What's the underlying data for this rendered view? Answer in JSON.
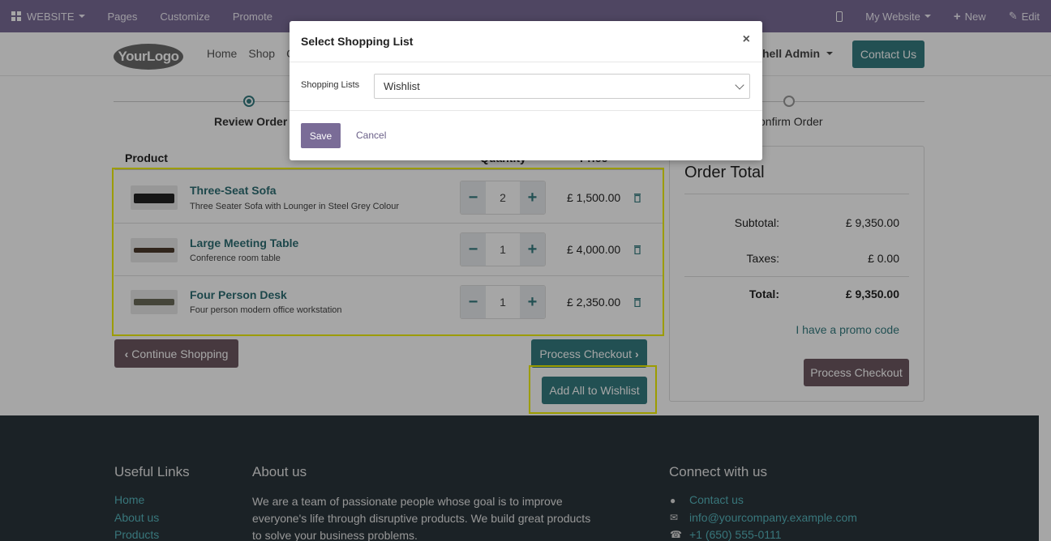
{
  "admin_bar": {
    "website": "WEBSITE",
    "pages": "Pages",
    "customize": "Customize",
    "promote": "Promote",
    "my_website": "My Website",
    "new": "New",
    "edit": "Edit"
  },
  "header": {
    "logo": "YourLogo",
    "nav": [
      "Home",
      "Shop",
      "C"
    ],
    "user": "hell Admin",
    "contact": "Contact Us"
  },
  "steps": {
    "review": "Review Order",
    "confirm": "onfirm Order"
  },
  "cart": {
    "col_product": "Product",
    "col_quantity": "Quantity",
    "col_price": "Price",
    "items": [
      {
        "name": "Three-Seat Sofa",
        "description": "Three Seater Sofa with Lounger in Steel Grey Colour",
        "quantity": "2",
        "price": "£ 1,500.00"
      },
      {
        "name": "Large Meeting Table",
        "description": "Conference room table",
        "quantity": "1",
        "price": "£ 4,000.00"
      },
      {
        "name": "Four Person Desk",
        "description": "Four person modern office workstation",
        "quantity": "1",
        "price": "£ 2,350.00"
      }
    ],
    "continue_shopping": "Continue Shopping",
    "process_checkout": "Process Checkout",
    "add_all_wishlist": "Add All to Wishlist"
  },
  "order_total": {
    "title": "Order Total",
    "subtotal_label": "Subtotal:",
    "subtotal": "£ 9,350.00",
    "taxes_label": "Taxes:",
    "taxes": "£ 0.00",
    "total_label": "Total:",
    "total": "£ 9,350.00",
    "promo": "I have a promo code",
    "checkout": "Process Checkout"
  },
  "footer": {
    "useful_links_title": "Useful Links",
    "links": [
      "Home",
      "About us",
      "Products"
    ],
    "about_title": "About us",
    "about_text": "We are a team of passionate people whose goal is to improve everyone's life through disruptive products. We build great products to solve your business problems.",
    "connect_title": "Connect with us",
    "contact_us": "Contact us",
    "email": "info@yourcompany.example.com",
    "phone": "+1 (650) 555-0111"
  },
  "modal": {
    "title": "Select Shopping List",
    "close": "×",
    "field_label": "Shopping Lists",
    "selected": "Wishlist",
    "save": "Save",
    "cancel": "Cancel"
  }
}
